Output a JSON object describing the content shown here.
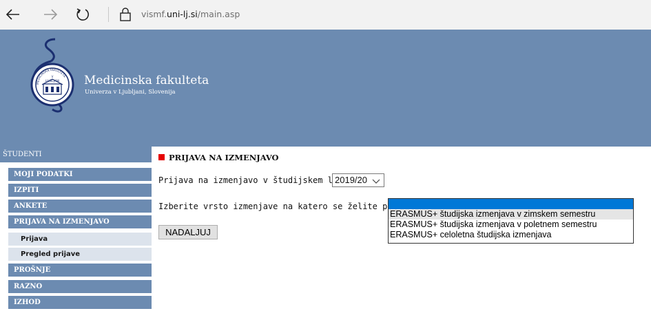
{
  "browser": {
    "url_prefix": "vismf.",
    "url_host": "uni-lj.si",
    "url_path": "/main.asp"
  },
  "header": {
    "faculty_name": "Medicinska fakulteta",
    "faculty_subtitle": "Univerza v Ljubljani, Slovenija",
    "bg_color": "#6c8bb1",
    "logo_seal_text": [
      "MEDICINSKA FAKULTETA",
      "V",
      "LJUBLJANI"
    ]
  },
  "sidebar": {
    "title": "ŠTUDENTI",
    "items": [
      {
        "label": "MOJI PODATKI"
      },
      {
        "label": "IZPITI"
      },
      {
        "label": "ANKETE"
      },
      {
        "label": "PRIJAVA NA IZMENJAVO"
      },
      {
        "label": "Prijava"
      },
      {
        "label": "Pregled prijave"
      },
      {
        "label": "PROŠNJE"
      },
      {
        "label": "RAZNO"
      },
      {
        "label": "IZHOD"
      }
    ]
  },
  "main": {
    "section_title": "PRIJAVA NA IZMENJAVO",
    "year_label": "Prijava na izmenjavo v študijskem letu:",
    "year_value": "2019/20",
    "type_label": "Izberite vrsto izmenjave na katero se želite prijaviti:",
    "type_options": [
      "ERASMUS+ študijska izmenjava v zimskem semestru",
      "ERASMUS+ študijska izmenjava v poletnem semestru",
      "ERASMUS+ celoletna študijska izmenjava"
    ],
    "next_button": "NADALJUJ",
    "accent_color": "#e60000"
  }
}
